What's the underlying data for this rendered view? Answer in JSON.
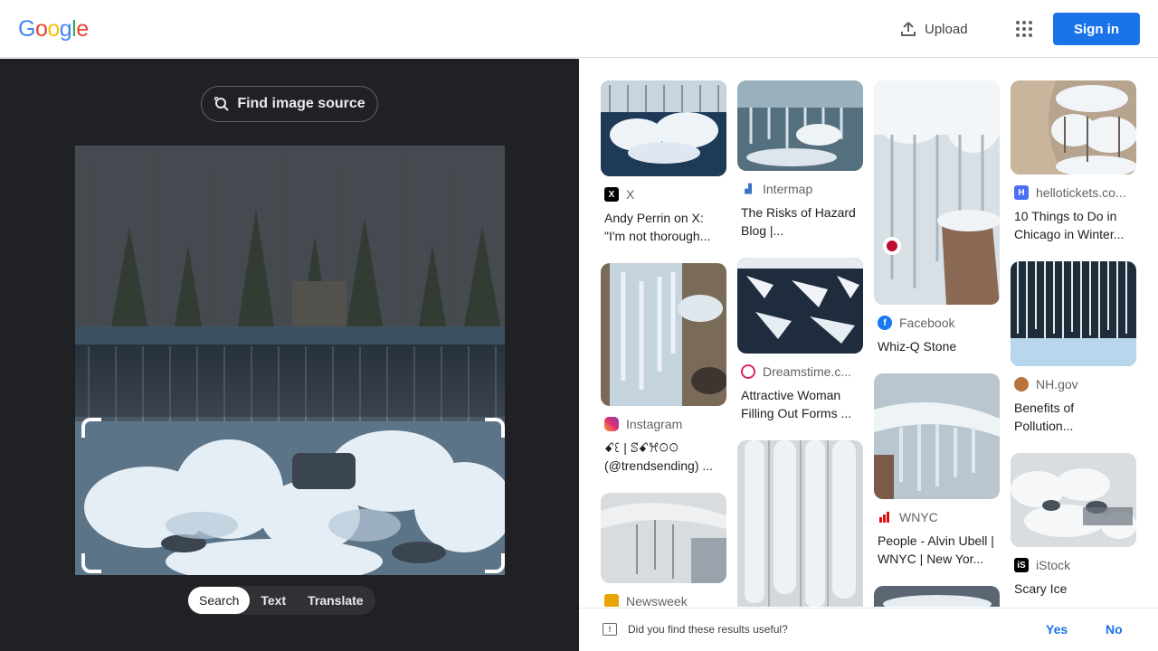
{
  "header": {
    "logo_letters": [
      "G",
      "o",
      "o",
      "g",
      "l",
      "e"
    ],
    "upload_label": "Upload",
    "signin_label": "Sign in"
  },
  "left": {
    "find_source_label": "Find image source",
    "modes": [
      "Search",
      "Text",
      "Translate"
    ],
    "active_mode": "Search"
  },
  "results": {
    "columns": [
      [
        {
          "source": "X",
          "title": "Andy Perrin on X: \"I'm not thorough...",
          "favicon": "x-icon"
        },
        {
          "source": "Instagram",
          "title": "ꗃꘓ | ꕷꗃꕮꖴꖴ (@trendsending) ...",
          "favicon": "instagram-icon"
        },
        {
          "source": "Newsweek",
          "title": "",
          "favicon": "newsweek-icon"
        }
      ],
      [
        {
          "source": "Intermap",
          "title": "The Risks of Hazard Blog |...",
          "favicon": "intermap-icon"
        },
        {
          "source": "Dreamstime.c...",
          "title": "Attractive Woman Filling Out Forms ...",
          "favicon": "dreamstime-icon"
        },
        {
          "source": "",
          "title": "",
          "favicon": ""
        }
      ],
      [
        {
          "source": "Facebook",
          "title": "Whiz-Q Stone",
          "favicon": "facebook-icon"
        },
        {
          "source": "WNYC",
          "title": "People - Alvin Ubell | WNYC | New Yor...",
          "favicon": "wnyc-icon"
        },
        {
          "source": "",
          "title": "",
          "favicon": ""
        }
      ],
      [
        {
          "source": "hellotickets.co...",
          "title": "10 Things to Do in Chicago in Winter...",
          "favicon": "hellotickets-icon"
        },
        {
          "source": "NH.gov",
          "title": "Benefits of Pollution...",
          "favicon": "nhgov-icon"
        },
        {
          "source": "iStock",
          "title": "Scary Ice",
          "favicon": "istock-icon"
        }
      ]
    ]
  },
  "feedback": {
    "question": "Did you find these results useful?",
    "yes_label": "Yes",
    "no_label": "No"
  },
  "colors": {
    "accent": "#1a73e8",
    "left_bg": "#202124"
  }
}
